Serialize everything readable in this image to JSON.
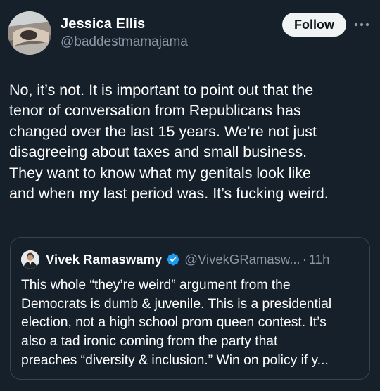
{
  "tweet": {
    "author_name": "Jessica Ellis",
    "author_handle": "@baddestmamajama",
    "follow_label": "Follow",
    "more_label": "···",
    "text": "No, it’s not. It is important to point out that the\ntenor of conversation from Republicans has\nchanged over the last 15 years. We’re not just\ndisagreeing about taxes and small business.\nThey want to know what my genitals look like\nand when my last period was. It’s fucking weird."
  },
  "quote": {
    "author_name": "Vivek Ramaswamy",
    "verified": true,
    "author_handle": "@VivekGRamasw...",
    "separator": "·",
    "time": "11h",
    "text": "This whole “they’re weird” argument from the\nDemocrats is dumb & juvenile. This is a presidential\nelection, not a high school prom queen contest. It’s\nalso a tad ironic coming from the party that\npreaches “diversity & inclusion.” Win on policy if y..."
  },
  "colors": {
    "background": "#15202b",
    "text_primary": "#ffffff",
    "text_secondary": "#8b98a5",
    "border": "#38444d",
    "follow_bg": "#eff3f4",
    "verified_blue": "#1d9bf0"
  },
  "icons": {
    "more": "more-horizontal-icon",
    "verified": "verified-badge-icon"
  }
}
